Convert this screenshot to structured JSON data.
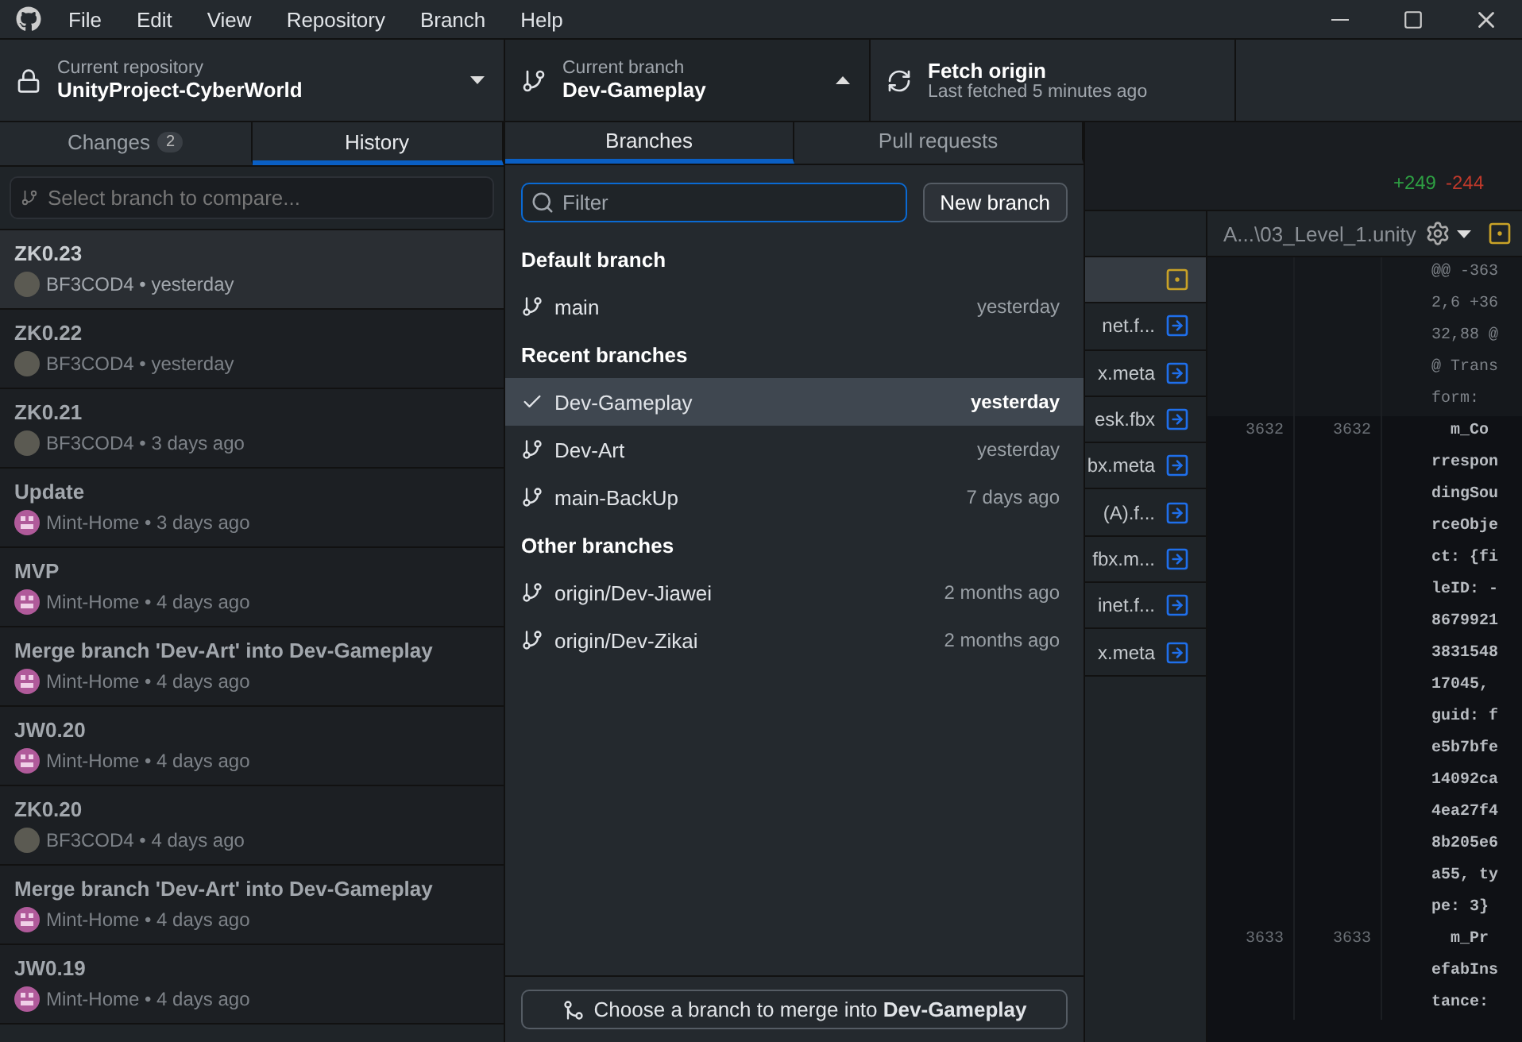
{
  "window": {
    "menu": [
      "File",
      "Edit",
      "View",
      "Repository",
      "Branch",
      "Help"
    ]
  },
  "toolbar": {
    "repository": {
      "label": "Current repository",
      "name": "UnityProject-CyberWorld"
    },
    "branch": {
      "label": "Current branch",
      "name": "Dev-Gameplay",
      "expanded": true
    },
    "fetch": {
      "title": "Fetch origin",
      "subtitle": "Last fetched 5 minutes ago"
    }
  },
  "left_tabs": [
    {
      "label": "Changes",
      "badge": "2",
      "selected": false
    },
    {
      "label": "History",
      "selected": true
    }
  ],
  "compare": {
    "placeholder": "Select branch to compare..."
  },
  "commits": [
    {
      "title": "ZK0.23",
      "meta": "BF3COD4 • yesterday",
      "kind": "photo",
      "selected": true
    },
    {
      "title": "ZK0.22",
      "meta": "BF3COD4 • yesterday",
      "kind": "photo",
      "selected": false
    },
    {
      "title": "ZK0.21",
      "meta": "BF3COD4 • 3 days ago",
      "kind": "photo",
      "selected": false
    },
    {
      "title": "Update",
      "meta": "Mint-Home • 3 days ago",
      "kind": "identicon",
      "selected": false
    },
    {
      "title": "MVP",
      "meta": "Mint-Home • 4 days ago",
      "kind": "identicon",
      "selected": false
    },
    {
      "title": "Merge branch 'Dev-Art' into Dev-Gameplay",
      "meta": "Mint-Home • 4 days ago",
      "kind": "identicon",
      "selected": false
    },
    {
      "title": "JW0.20",
      "meta": "Mint-Home • 4 days ago",
      "kind": "identicon",
      "selected": false
    },
    {
      "title": "ZK0.20",
      "meta": "BF3COD4 • 4 days ago",
      "kind": "photo",
      "selected": false
    },
    {
      "title": "Merge branch 'Dev-Art' into Dev-Gameplay",
      "meta": "Mint-Home • 4 days ago",
      "kind": "identicon",
      "selected": false
    },
    {
      "title": "JW0.19",
      "meta": "Mint-Home • 4 days ago",
      "kind": "identicon",
      "selected": false
    }
  ],
  "summary": {
    "additions": "+249",
    "deletions": "-244"
  },
  "files": [
    {
      "kind": "modified",
      "selected": true
    },
    {
      "name": "net.f...",
      "kind": "renamed",
      "selected": false
    },
    {
      "name": "x.meta",
      "kind": "renamed",
      "selected": false
    },
    {
      "name": "esk.fbx",
      "kind": "renamed",
      "selected": false
    },
    {
      "name": "bx.meta",
      "kind": "renamed",
      "selected": false
    },
    {
      "name": "(A).f...",
      "kind": "renamed",
      "selected": false
    },
    {
      "name": "fbx.m...",
      "kind": "renamed",
      "selected": false
    },
    {
      "name": "inet.f...",
      "kind": "renamed",
      "selected": false
    },
    {
      "name": "x.meta",
      "kind": "renamed",
      "selected": false
    }
  ],
  "diff": {
    "path": "A...\\03_Level_1.unity",
    "lines": [
      {
        "kind": "hunk",
        "text": "@@ -3632,6 +3632,88 @@ Transform:"
      },
      {
        "kind": "context",
        "old": "3632",
        "new": "3632",
        "text": "  m_CorrespondingSourceObject: {fileID: -8679921383154817045, guid: fe5b7bfe14092ca4ea27f48b205e6a55, type: 3}"
      },
      {
        "kind": "context",
        "old": "3633",
        "new": "3633",
        "text": "  m_PrefabInstance:"
      }
    ]
  },
  "branch_menu": {
    "tabs": [
      {
        "label": "Branches",
        "selected": true
      },
      {
        "label": "Pull requests",
        "selected": false
      }
    ],
    "filter": {
      "placeholder": "Filter"
    },
    "new_button": "New branch",
    "groups": [
      {
        "title": "Default branch",
        "items": [
          {
            "name": "main",
            "time": "yesterday",
            "selected": false
          }
        ]
      },
      {
        "title": "Recent branches",
        "items": [
          {
            "name": "Dev-Gameplay",
            "time": "yesterday",
            "selected": true
          },
          {
            "name": "Dev-Art",
            "time": "yesterday",
            "selected": false
          },
          {
            "name": "main-BackUp",
            "time": "7 days ago",
            "selected": false
          }
        ]
      },
      {
        "title": "Other branches",
        "items": [
          {
            "name": "origin/Dev-Jiawei",
            "time": "2 months ago",
            "selected": false
          },
          {
            "name": "origin/Dev-Zikai",
            "time": "2 months ago",
            "selected": false
          }
        ]
      }
    ],
    "merge_button": "Choose a branch to merge into **Dev-Gameplay**"
  }
}
